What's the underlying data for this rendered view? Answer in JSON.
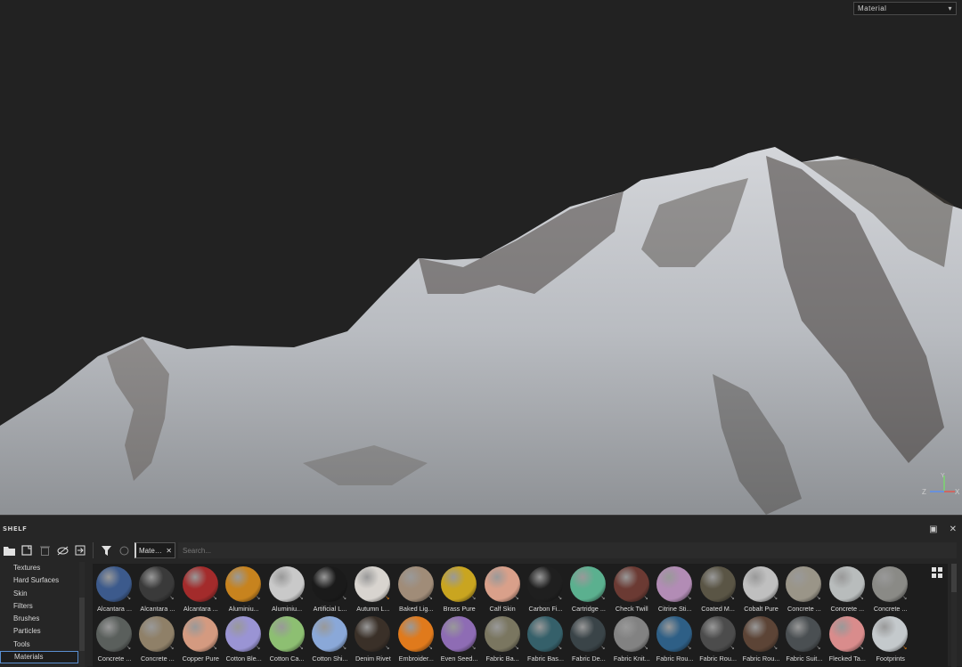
{
  "viewport": {
    "view_mode": "Material"
  },
  "shelf": {
    "title": "SHELF",
    "filter_chip_label": "Mate…",
    "search_placeholder": "Search...",
    "categories": [
      {
        "label": "Textures",
        "active": false
      },
      {
        "label": "Hard Surfaces",
        "active": false
      },
      {
        "label": "Skin",
        "active": false
      },
      {
        "label": "Filters",
        "active": false
      },
      {
        "label": "Brushes",
        "active": false
      },
      {
        "label": "Particles",
        "active": false
      },
      {
        "label": "Tools",
        "active": false
      },
      {
        "label": "Materials",
        "active": true
      }
    ],
    "materials_row1": [
      {
        "label": "Alcantara ...",
        "color": "#3c5a8c"
      },
      {
        "label": "Alcantara ...",
        "color": "#3a3a3a"
      },
      {
        "label": "Alcantara ...",
        "color": "#a32b2b"
      },
      {
        "label": "Aluminiu...",
        "color": "#c7831e"
      },
      {
        "label": "Aluminiu...",
        "color": "#c9c9c9"
      },
      {
        "label": "Artificial L...",
        "color": "#1a1a1a"
      },
      {
        "label": "Autumn L...",
        "color": "#d8d4cf"
      },
      {
        "label": "Baked Lig...",
        "color": "#a08c78"
      },
      {
        "label": "Brass Pure",
        "color": "#c9a520"
      },
      {
        "label": "Calf Skin",
        "color": "#d9a08a"
      },
      {
        "label": "Carbon Fi...",
        "color": "#1f1f1f"
      },
      {
        "label": "Cartridge ...",
        "color": "#5bb08f"
      },
      {
        "label": "Check Twill",
        "color": "#6b3a33"
      },
      {
        "label": "Citrine Sti...",
        "color": "#b28cb5"
      },
      {
        "label": "Coated M...",
        "color": "#5a5545"
      },
      {
        "label": "Cobalt Pure",
        "color": "#bfbfbf"
      },
      {
        "label": "Concrete ...",
        "color": "#9a9588"
      },
      {
        "label": "Concrete ...",
        "color": "#b8bcbc"
      },
      {
        "label": "Concrete ...",
        "color": "#8a8a86"
      }
    ],
    "materials_row2": [
      {
        "label": "Concrete ...",
        "color": "#5a5f5c"
      },
      {
        "label": "Concrete ...",
        "color": "#8f8068"
      },
      {
        "label": "Copper Pure",
        "color": "#d49a80"
      },
      {
        "label": "Cotton Ble...",
        "color": "#9a94d4"
      },
      {
        "label": "Cotton Ca...",
        "color": "#8dbf72"
      },
      {
        "label": "Cotton Shi...",
        "color": "#8aa8d8"
      },
      {
        "label": "Denim Rivet",
        "color": "#3a3028"
      },
      {
        "label": "Embroider...",
        "color": "#e07a1c"
      },
      {
        "label": "Even Seed...",
        "color": "#8e6cb4"
      },
      {
        "label": "Fabric Ba...",
        "color": "#7a7660"
      },
      {
        "label": "Fabric Bas...",
        "color": "#35606a"
      },
      {
        "label": "Fabric De...",
        "color": "#3a4448"
      },
      {
        "label": "Fabric Knit...",
        "color": "#828282"
      },
      {
        "label": "Fabric Rou...",
        "color": "#2e5f86"
      },
      {
        "label": "Fabric Rou...",
        "color": "#4c4c4c"
      },
      {
        "label": "Fabric Rou...",
        "color": "#5c4436"
      },
      {
        "label": "Fabric Suit...",
        "color": "#4a4f52"
      },
      {
        "label": "Flecked Ta...",
        "color": "#d98c8c"
      },
      {
        "label": "Footprints",
        "color": "#c4c9cc"
      }
    ]
  },
  "gizmo": {
    "x_label": "X",
    "y_label": "Y",
    "z_label": "Z"
  }
}
